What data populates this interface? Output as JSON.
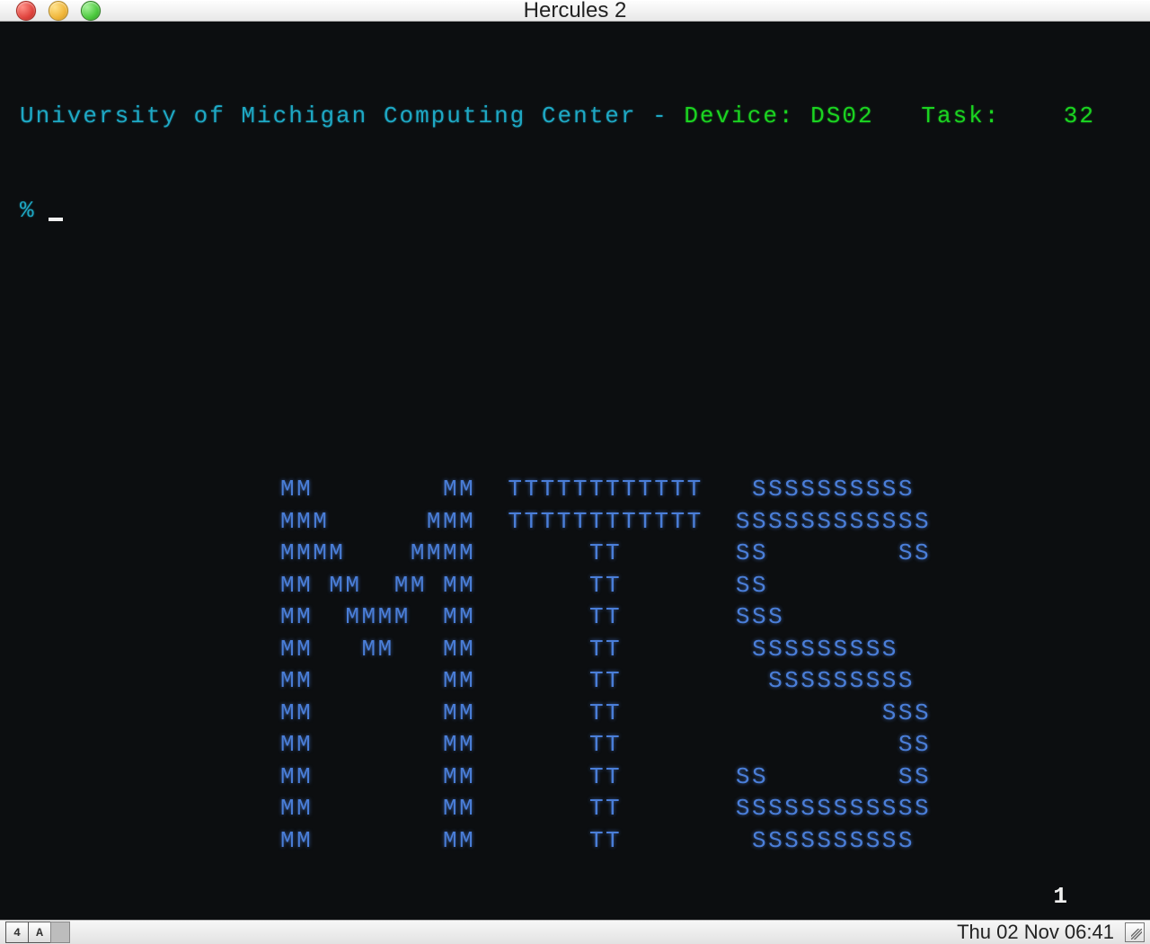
{
  "window": {
    "title": "Hercules 2"
  },
  "terminal": {
    "header_left": "University of Michigan Computing Center - ",
    "device_label": "Device: ",
    "device_value": "DS02",
    "task_label": "   Task:    ",
    "task_value": "32",
    "prompt_char": "%",
    "banner_lines": [
      "MM        MM  TTTTTTTTTTTT   SSSSSSSSSS ",
      "MMM      MMM  TTTTTTTTTTTT  SSSSSSSSSSSS",
      "MMMM    MMMM       TT       SS        SS",
      "MM MM  MM MM       TT       SS          ",
      "MM  MMMM  MM       TT       SSS         ",
      "MM   MM   MM       TT        SSSSSSSSS  ",
      "MM        MM       TT         SSSSSSSSS ",
      "MM        MM       TT                SSS",
      "MM        MM       TT                 SS",
      "MM        MM       TT       SS        SS",
      "MM        MM       TT       SSSSSSSSSSSS",
      "MM        MM       TT        SSSSSSSSSS "
    ],
    "status_number": "1"
  },
  "bottombar": {
    "indicator1": "4",
    "indicator2": "A",
    "datetime": "Thu 02 Nov 06:41"
  }
}
